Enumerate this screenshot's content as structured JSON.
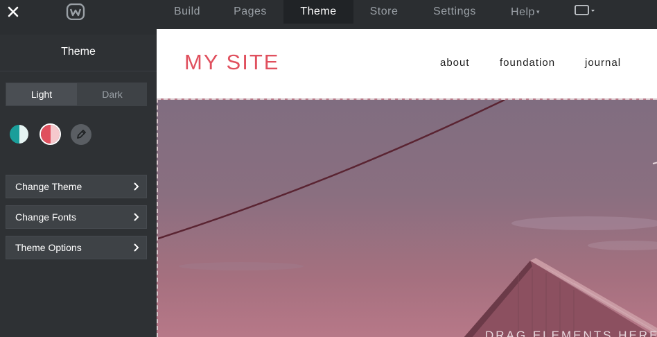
{
  "topbar": {
    "close_icon": "close-icon",
    "logo_icon": "weebly-w-logo",
    "tabs": [
      {
        "label": "Build"
      },
      {
        "label": "Pages"
      },
      {
        "label": "Theme"
      },
      {
        "label": "Store"
      },
      {
        "label": "Settings"
      },
      {
        "label": "Help"
      }
    ],
    "device_icon": "desktop-view-icon"
  },
  "sidebar": {
    "title": "Theme",
    "segmented": {
      "light": "Light",
      "dark": "Dark",
      "selected": "Light"
    },
    "palette": [
      {
        "name": "teal",
        "left": "#1a9e9a",
        "right": "#e6f4f3"
      },
      {
        "name": "coral",
        "left": "#e0505e",
        "right": "#f6c9cd"
      }
    ],
    "edit_icon": "pencil-icon",
    "menu": [
      {
        "label": "Change Theme"
      },
      {
        "label": "Change Fonts"
      },
      {
        "label": "Theme Options"
      }
    ]
  },
  "preview": {
    "site_title": "MY SITE",
    "nav": [
      {
        "label": "about"
      },
      {
        "label": "foundation"
      },
      {
        "label": "journal"
      }
    ],
    "hero_text": "DRAG ELEMENTS HERE"
  },
  "colors": {
    "accent": "#e0505e",
    "topbar_bg": "#2b2e31",
    "active_tab_bg": "#202326"
  }
}
